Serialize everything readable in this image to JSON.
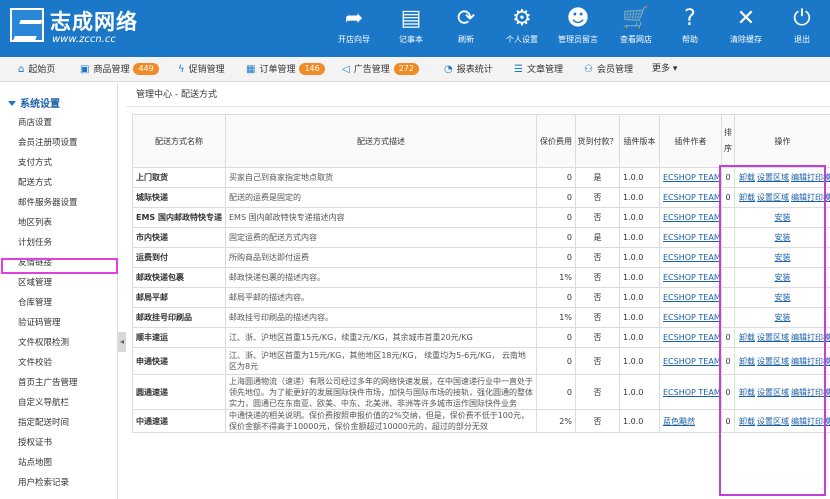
{
  "logo": {
    "name": "志成网络",
    "url": "www.zccn.cc"
  },
  "toolbar": [
    {
      "label": "开店向导",
      "icon": "arrow-share-icon",
      "glyph": "➦"
    },
    {
      "label": "记事本",
      "icon": "notepad-icon",
      "glyph": "▤"
    },
    {
      "label": "刷新",
      "icon": "refresh-icon",
      "glyph": "⟳"
    },
    {
      "label": "个人设置",
      "icon": "gear-icon",
      "glyph": "⚙"
    },
    {
      "label": "管理员留言",
      "icon": "smiley-message-icon",
      "glyph": "☻"
    },
    {
      "label": "查看网店",
      "icon": "shopping-cart-icon",
      "glyph": "🛒"
    },
    {
      "label": "帮助",
      "icon": "help-icon",
      "glyph": "?"
    },
    {
      "label": "清除缓存",
      "icon": "clear-cache-icon",
      "glyph": "✕"
    },
    {
      "label": "退出",
      "icon": "power-icon",
      "glyph": "⏻"
    }
  ],
  "nav": [
    {
      "label": "起始页",
      "icon": "home-icon",
      "glyph": "⌂"
    },
    {
      "label": "商品管理",
      "icon": "product-icon",
      "glyph": "▣",
      "badge": "449"
    },
    {
      "label": "促销管理",
      "icon": "promotion-icon",
      "glyph": "ϟ"
    },
    {
      "label": "订单管理",
      "icon": "order-icon",
      "glyph": "▦",
      "badge": "146"
    },
    {
      "label": "广告管理",
      "icon": "ad-icon",
      "glyph": "◁",
      "badge": "272"
    },
    {
      "label": "报表统计",
      "icon": "report-icon",
      "glyph": "◔"
    },
    {
      "label": "文章管理",
      "icon": "article-icon",
      "glyph": "☰"
    },
    {
      "label": "会员管理",
      "icon": "members-icon",
      "glyph": "⚇"
    },
    {
      "label": "更多 ▾"
    }
  ],
  "sidebar": {
    "title": "系统设置",
    "items": [
      "商店设置",
      "会员注册项设置",
      "支付方式",
      "配送方式",
      "邮件服务器设置",
      "地区列表",
      "计划任务",
      "友情链接",
      "区域管理",
      "仓库管理",
      "验证码管理",
      "文件权限检测",
      "文件校验",
      "首页主广告管理",
      "自定义导航栏",
      "指定配送时间",
      "授权证书",
      "站点地图",
      "用户检索记录"
    ],
    "active": "配送方式"
  },
  "breadcrumb": {
    "home": "管理中心",
    "sep": " - ",
    "current": "配送方式"
  },
  "table": {
    "headers": [
      "配送方式名称",
      "配送方式描述",
      "保价费用",
      "货到付款？",
      "插件版本",
      "插件作者",
      "排序",
      "操作"
    ],
    "op_labels": {
      "uninstall": "卸载",
      "set_region": "设置区域",
      "edit_print": "编辑打印模板",
      "install": "安装"
    },
    "rows": [
      {
        "name": "上门取货",
        "desc": "买家自己到商家指定地点取货",
        "fee": "0",
        "cod": "是",
        "version": "1.0.0",
        "author": "ECSHOP TEAM",
        "sort": "0",
        "installed": true
      },
      {
        "name": "城际快递",
        "desc": "配送的运费是固定的",
        "fee": "0",
        "cod": "否",
        "version": "1.0.0",
        "author": "ECSHOP TEAM",
        "sort": "0",
        "installed": true
      },
      {
        "name": "EMS 国内邮政特快专递",
        "desc": "EMS 国内邮政特快专递描述内容",
        "fee": "0",
        "cod": "否",
        "version": "1.0.0",
        "author": "ECSHOP TEAM",
        "sort": "",
        "installed": false
      },
      {
        "name": "市内快递",
        "desc": "固定运费的配送方式内容",
        "fee": "0",
        "cod": "是",
        "version": "1.0.0",
        "author": "ECSHOP TEAM",
        "sort": "",
        "installed": false
      },
      {
        "name": "运费到付",
        "desc": "所购商品到达即付运费",
        "fee": "0",
        "cod": "否",
        "version": "1.0.0",
        "author": "ECSHOP TEAM",
        "sort": "",
        "installed": false
      },
      {
        "name": "邮政快递包裹",
        "desc": "邮政快递包裹的描述内容。",
        "fee": "1%",
        "cod": "否",
        "version": "1.0.0",
        "author": "ECSHOP TEAM",
        "sort": "",
        "installed": false
      },
      {
        "name": "邮局平邮",
        "desc": "邮局平邮的描述内容。",
        "fee": "0",
        "cod": "否",
        "version": "1.0.0",
        "author": "ECSHOP TEAM",
        "sort": "",
        "installed": false
      },
      {
        "name": "邮政挂号印刷品",
        "desc": "邮政挂号印刷品的描述内容。",
        "fee": "1%",
        "cod": "否",
        "version": "1.0.0",
        "author": "ECSHOP TEAM",
        "sort": "",
        "installed": false
      },
      {
        "name": "顺丰速运",
        "desc": "江、浙、沪地区首重15元/KG，续重2元/KG，其余城市首重20元/KG",
        "fee": "0",
        "cod": "否",
        "version": "1.0.0",
        "author": "ECSHOP TEAM",
        "sort": "0",
        "installed": true
      },
      {
        "name": "申通快递",
        "desc": "江、浙、沪地区首重为15元/KG，其他地区18元/KG， 续重均为5-6元/KG， 云南地区为8元",
        "fee": "0",
        "cod": "否",
        "version": "1.0.0",
        "author": "ECSHOP TEAM",
        "sort": "0",
        "installed": true
      },
      {
        "name": "圆通速递",
        "desc": "上海圆通物流（速递）有限公司经过多年的网络快速发展，在中国速递行业中一直处于领先地位。为了能更好的发展国际快件市场，加快与国际市场的接轨，强化圆通的整体实力，圆通已在东南亚、欧美、中东、北美洲、非洲等许多城市运作国际快件业务",
        "fee": "0",
        "cod": "否",
        "version": "1.0.0",
        "author": "ECSHOP TEAM",
        "sort": "0",
        "installed": true
      },
      {
        "name": "中通速递",
        "desc": "中通快递的相关说明。保价费按照申报价值的2%交纳，但是，保价费不低于100元，保价金额不得高于10000元，保价金额超过10000元的，超过的部分无效",
        "fee": "2%",
        "cod": "否",
        "version": "1.0.0",
        "author": "蓝色黯然",
        "sort": "0",
        "installed": true
      }
    ]
  }
}
